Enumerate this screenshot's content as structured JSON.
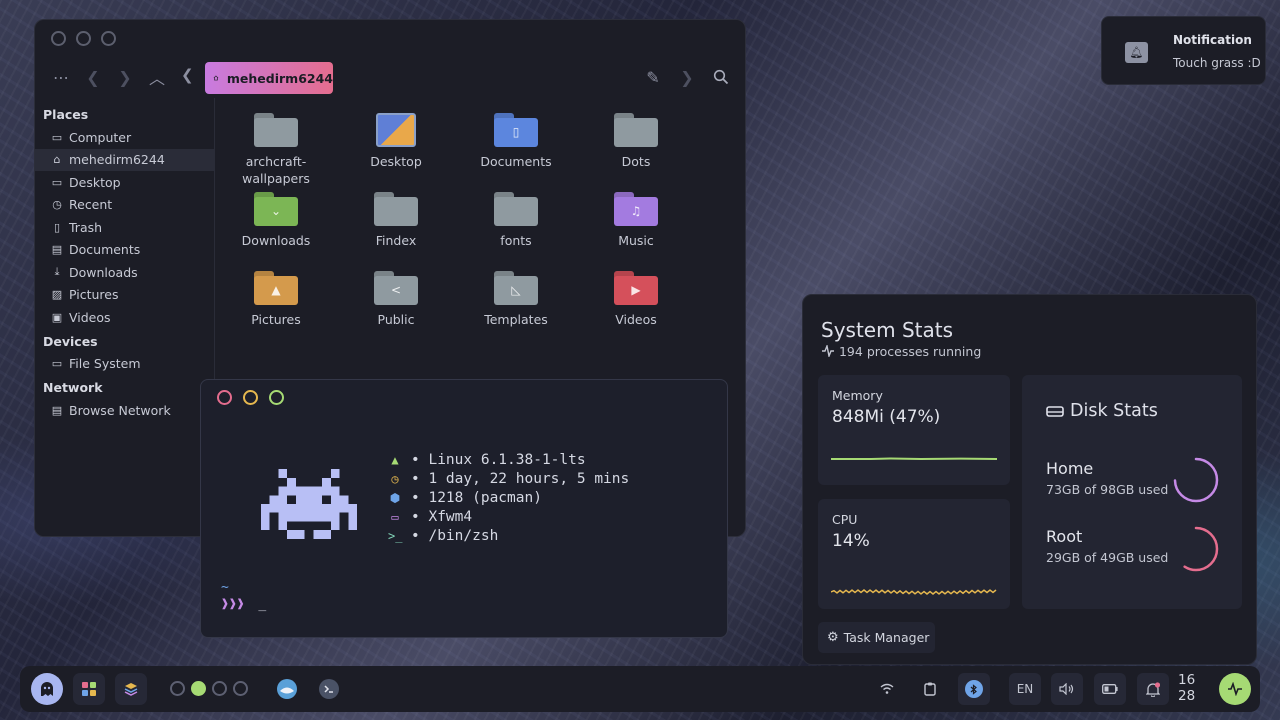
{
  "file_manager": {
    "location": "mehedirm6244",
    "sidebar": [
      {
        "heading": "Places",
        "items": [
          {
            "label": "Computer",
            "icon": "computer-icon"
          },
          {
            "label": "mehedirm6244",
            "icon": "home-icon",
            "active": true
          },
          {
            "label": "Desktop",
            "icon": "desktop-icon"
          },
          {
            "label": "Recent",
            "icon": "recent-icon"
          },
          {
            "label": "Trash",
            "icon": "trash-icon"
          },
          {
            "label": "Documents",
            "icon": "documents-icon"
          },
          {
            "label": "Downloads",
            "icon": "downloads-icon"
          },
          {
            "label": "Pictures",
            "icon": "pictures-icon"
          },
          {
            "label": "Videos",
            "icon": "videos-icon"
          }
        ]
      },
      {
        "heading": "Devices",
        "items": [
          {
            "label": "File System",
            "icon": "drive-icon"
          }
        ]
      },
      {
        "heading": "Network",
        "items": [
          {
            "label": "Browse Network",
            "icon": "network-icon"
          }
        ]
      }
    ],
    "folders": [
      {
        "label": "archcraft-wallpapers",
        "color": "#8f9aa0",
        "icon": ""
      },
      {
        "label": "Desktop",
        "color": "#5f7fd6",
        "icon": "desktop"
      },
      {
        "label": "Documents",
        "color": "#5c86de",
        "icon": "▯"
      },
      {
        "label": "Dots",
        "color": "#8f9aa0",
        "icon": ""
      },
      {
        "label": "Downloads",
        "color": "#7cb655",
        "icon": "⌄"
      },
      {
        "label": "Findex",
        "color": "#8f9aa0",
        "icon": ""
      },
      {
        "label": "fonts",
        "color": "#8f9aa0",
        "icon": ""
      },
      {
        "label": "Music",
        "color": "#a37be0",
        "icon": "♫"
      },
      {
        "label": "Pictures",
        "color": "#d49a4c",
        "icon": "▲"
      },
      {
        "label": "Public",
        "color": "#8f9aa0",
        "icon": "<"
      },
      {
        "label": "Templates",
        "color": "#8f9aa0",
        "icon": "◺"
      },
      {
        "label": "Videos",
        "color": "#d5505b",
        "icon": "▶"
      }
    ]
  },
  "terminal": {
    "fetch": [
      {
        "icon": "arch-icon",
        "glyph": "▲",
        "color": "#a6da74",
        "text": "• Linux 6.1.38-1-lts"
      },
      {
        "icon": "clock-icon",
        "glyph": "◷",
        "color": "#e6b84f",
        "text": "• 1 day, 22 hours, 5 mins"
      },
      {
        "icon": "package-icon",
        "glyph": "⬢",
        "color": "#6fa4e8",
        "text": "• 1218 (pacman)"
      },
      {
        "icon": "window-manager-icon",
        "glyph": "▭",
        "color": "#c58ae6",
        "text": "• Xfwm4"
      },
      {
        "icon": "shell-icon",
        "glyph": ">_",
        "color": "#82d4b8",
        "text": "• /bin/zsh"
      }
    ],
    "cwd": "~",
    "prompt_symbol": "❱❱❱",
    "cursor": "_"
  },
  "notification": {
    "title": "Notification",
    "body": "Touch grass :D"
  },
  "system_stats": {
    "title": "System Stats",
    "processes": "194 processes running",
    "memory": {
      "label": "Memory",
      "value": "848Mi (47%)",
      "color": "#a6da74"
    },
    "cpu": {
      "label": "CPU",
      "value": "14%",
      "color": "#e6b84f"
    },
    "disk": {
      "title": "Disk Stats",
      "home": {
        "name": "Home",
        "used": "73GB of 98GB used",
        "fraction": 0.745,
        "color": "#c58ae6"
      },
      "root": {
        "name": "Root",
        "used": "29GB of 49GB used",
        "fraction": 0.59,
        "color": "#e46d8e"
      }
    },
    "task_manager": "Task Manager"
  },
  "taskbar": {
    "workspaces": [
      false,
      true,
      false,
      false
    ],
    "language": "EN",
    "clock_hour": "16",
    "clock_minute": "28",
    "accent": "#a6da74"
  }
}
